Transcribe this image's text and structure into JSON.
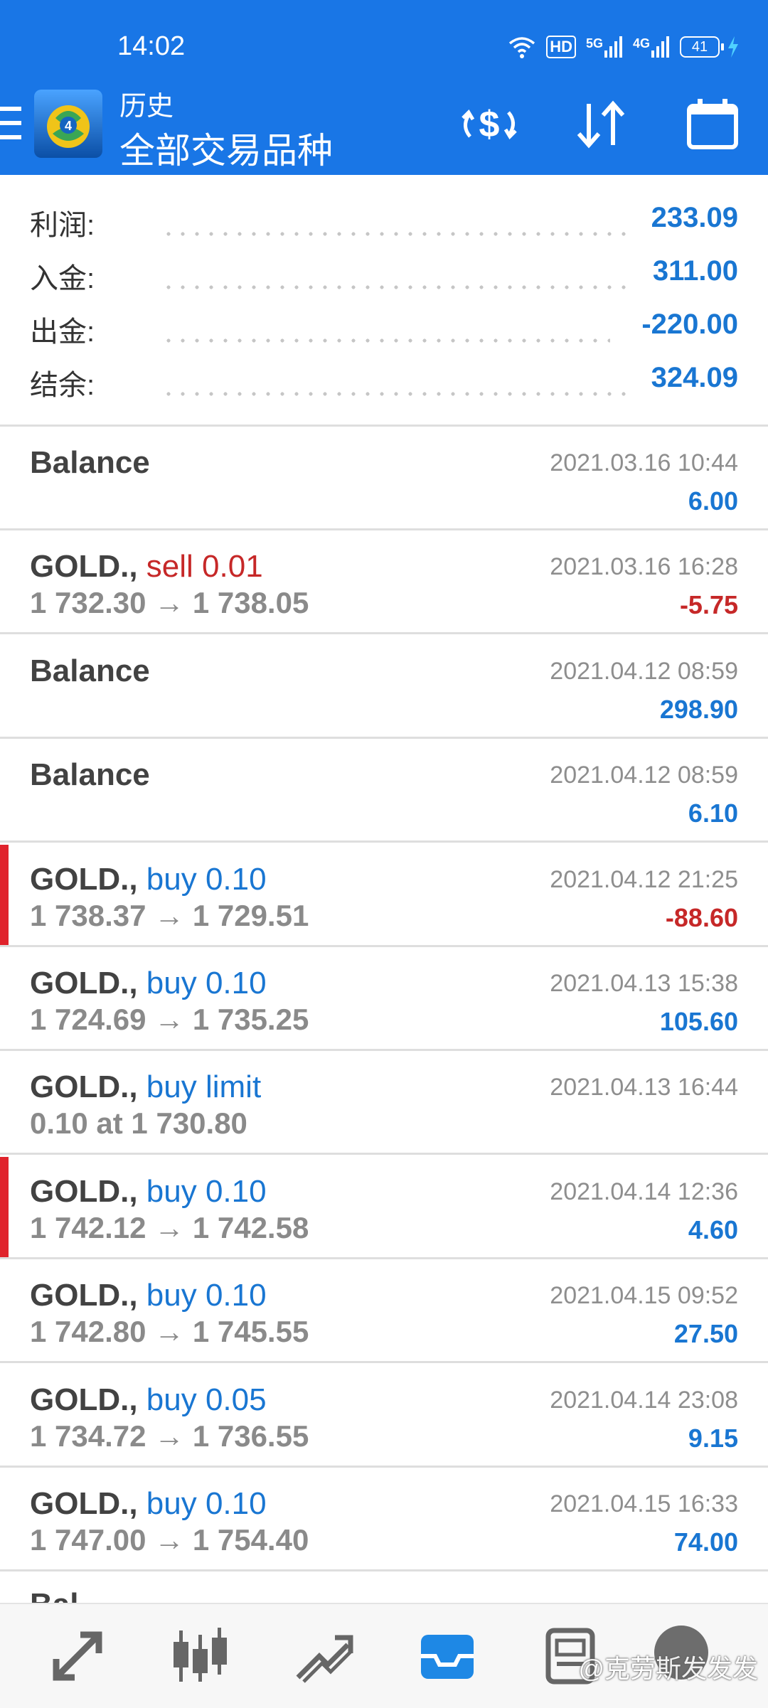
{
  "status_bar": {
    "time": "14:02",
    "battery": "41",
    "net_1": "5G",
    "net_2": "4G",
    "hd": "HD"
  },
  "header": {
    "title": "历史",
    "subtitle": "全部交易品种"
  },
  "summary": [
    {
      "label": "利润:",
      "value": "233.09"
    },
    {
      "label": "入金:",
      "value": "311.00"
    },
    {
      "label": "出金:",
      "value": "-220.00"
    },
    {
      "label": "结余:",
      "value": "324.09"
    }
  ],
  "history": [
    {
      "symbol": "Balance",
      "action": "",
      "detail": "",
      "time": "2021.03.16 10:44",
      "profit": "6.00",
      "negative": false,
      "marked": false
    },
    {
      "symbol": "GOLD.,",
      "action": "sell 0.01",
      "detail": "1 732.30 → 1 738.05",
      "time": "2021.03.16 16:28",
      "profit": "-5.75",
      "negative": true,
      "marked": false
    },
    {
      "symbol": "Balance",
      "action": "",
      "detail": "",
      "time": "2021.04.12 08:59",
      "profit": "298.90",
      "negative": false,
      "marked": false
    },
    {
      "symbol": "Balance",
      "action": "",
      "detail": "",
      "time": "2021.04.12 08:59",
      "profit": "6.10",
      "negative": false,
      "marked": false
    },
    {
      "symbol": "GOLD.,",
      "action": "buy 0.10",
      "detail": "1 738.37 → 1 729.51",
      "time": "2021.04.12 21:25",
      "profit": "-88.60",
      "negative": true,
      "marked": true
    },
    {
      "symbol": "GOLD.,",
      "action": "buy 0.10",
      "detail": "1 724.69 → 1 735.25",
      "time": "2021.04.13 15:38",
      "profit": "105.60",
      "negative": false,
      "marked": false
    },
    {
      "symbol": "GOLD.,",
      "action": "buy limit",
      "detail": "0.10 at 1 730.80",
      "time": "2021.04.13 16:44",
      "profit": "",
      "negative": false,
      "marked": false
    },
    {
      "symbol": "GOLD.,",
      "action": "buy 0.10",
      "detail": "1 742.12 → 1 742.58",
      "time": "2021.04.14 12:36",
      "profit": "4.60",
      "negative": false,
      "marked": true
    },
    {
      "symbol": "GOLD.,",
      "action": "buy 0.10",
      "detail": "1 742.80 → 1 745.55",
      "time": "2021.04.15 09:52",
      "profit": "27.50",
      "negative": false,
      "marked": false
    },
    {
      "symbol": "GOLD.,",
      "action": "buy 0.05",
      "detail": "1 734.72 → 1 736.55",
      "time": "2021.04.14 23:08",
      "profit": "9.15",
      "negative": false,
      "marked": false
    },
    {
      "symbol": "GOLD.,",
      "action": "buy 0.10",
      "detail": "1 747.00 → 1 754.40",
      "time": "2021.04.15 16:33",
      "profit": "74.00",
      "negative": false,
      "marked": false
    }
  ],
  "partial_row_text": "Bal",
  "bottom_nav": [
    {
      "name": "quotes",
      "icon": "quotes-icon"
    },
    {
      "name": "chart",
      "icon": "candlestick-icon"
    },
    {
      "name": "trade",
      "icon": "trade-icon"
    },
    {
      "name": "history",
      "icon": "history-inbox-icon",
      "active": true
    },
    {
      "name": "news",
      "icon": "news-icon"
    }
  ],
  "watermark": "@克劳斯发发发",
  "colors": {
    "header": "#1976e6",
    "positive": "#1976d2",
    "negative": "#c62828",
    "marker": "#e0232c"
  }
}
